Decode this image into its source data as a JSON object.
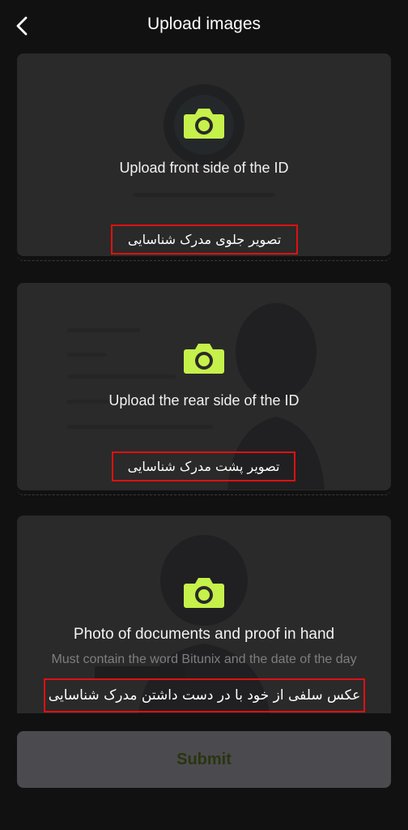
{
  "header": {
    "title": "Upload images",
    "back_icon": "chevron-left-icon"
  },
  "cards": [
    {
      "label": "Upload front side of the ID",
      "annotation": "تصویر جلوی مدرک شناسایی",
      "icon": "camera-icon"
    },
    {
      "label": "Upload the rear side of the ID",
      "annotation": "تصویر پشت مدرک شناسایی",
      "icon": "camera-icon"
    },
    {
      "label": "Photo of documents and proof in hand",
      "sublabel": "Must contain the word Bitunix and the date of the day",
      "annotation": "عکس سلفی از خود با در دست داشتن مدرک شناسایی",
      "icon": "camera-icon"
    }
  ],
  "submit": {
    "label": "Submit"
  },
  "colors": {
    "accent": "#c6f14a",
    "annotation_border": "#e01010",
    "card_bg": "#2a2a2a",
    "page_bg": "#111111",
    "submit_bg": "#4b4b4f"
  }
}
